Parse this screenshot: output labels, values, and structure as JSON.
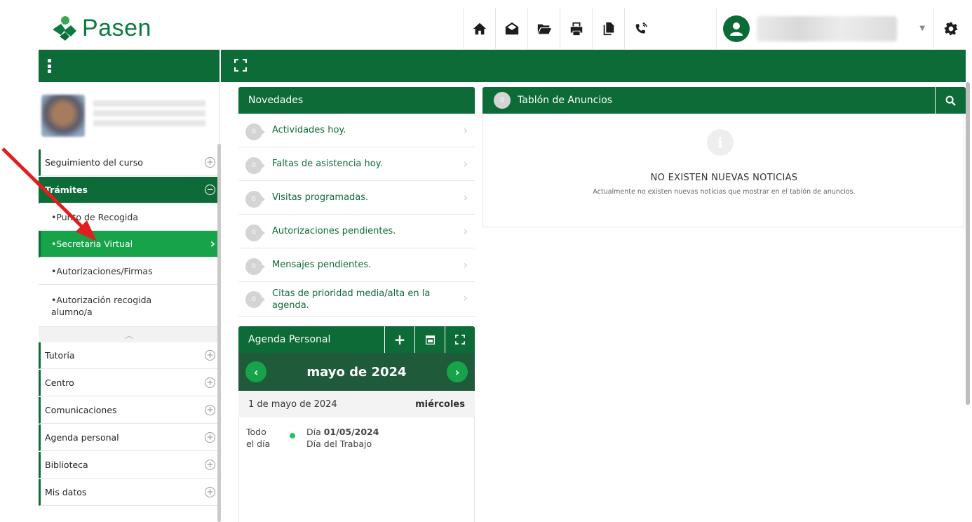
{
  "app": {
    "name": "Pasen"
  },
  "colors": {
    "brand": "#0d6b37",
    "accent": "#16a34a",
    "annotation": "#e11d1d"
  },
  "header": {
    "icons": [
      "home-icon",
      "mail-open-icon",
      "folder-open-icon",
      "print-icon",
      "documents-icon",
      "phone-call-icon"
    ],
    "settings_icon": "gear-icon"
  },
  "sidebar": {
    "items": [
      {
        "label": "Seguimiento del curso"
      },
      {
        "label": "Trámites"
      },
      {
        "label": "Tutoría"
      },
      {
        "label": "Centro"
      },
      {
        "label": "Comunicaciones"
      },
      {
        "label": "Agenda personal"
      },
      {
        "label": "Biblioteca"
      },
      {
        "label": "Mis datos"
      }
    ],
    "tramites_sub": [
      {
        "label": "•Punto de Recogida"
      },
      {
        "label": "•Secretaría Virtual"
      },
      {
        "label": "•Autorizaciones/Firmas"
      },
      {
        "label": "•Autorización recogida alumno/a"
      }
    ]
  },
  "novedades": {
    "title": "Novedades",
    "items": [
      {
        "label": "Actividades hoy.",
        "count": "0"
      },
      {
        "label": "Faltas de asistencia hoy.",
        "count": "0"
      },
      {
        "label": "Visitas programadas.",
        "count": "0"
      },
      {
        "label": "Autorizaciones pendientes.",
        "count": "0"
      },
      {
        "label": "Mensajes pendientes.",
        "count": "0"
      },
      {
        "label": "Citas de prioridad media/alta en la agenda.",
        "count": "0"
      }
    ]
  },
  "agenda": {
    "title": "Agenda Personal",
    "month": "mayo de 2024",
    "day_label": "1 de mayo de 2024",
    "weekday": "miércoles",
    "event": {
      "time_line1": "Todo",
      "time_line2": "el día",
      "date_prefix": "Día ",
      "date": "01/05/2024",
      "title": "Día del Trabajo"
    }
  },
  "tablon": {
    "title": "Tablón de Anuncios",
    "badge": "0",
    "empty_title": "NO EXISTEN NUEVAS NOTICIAS",
    "empty_desc": "Actualmente no existen nuevas noticias que mostrar en el tablón de anuncios."
  }
}
